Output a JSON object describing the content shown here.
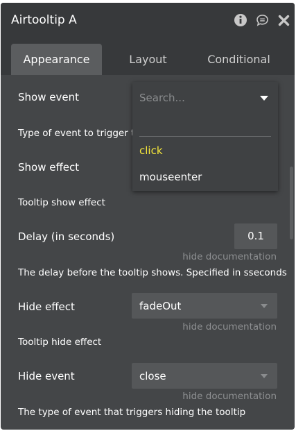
{
  "window": {
    "title": "Airtooltip A",
    "icons": [
      "info-icon",
      "comment-icon",
      "close-icon"
    ]
  },
  "tabs": [
    "Appearance",
    "Layout",
    "Conditional"
  ],
  "active_tab": "Appearance",
  "fields": {
    "show_event": {
      "label": "Show event",
      "description": "Type of event to trigger to"
    },
    "show_effect": {
      "label": "Show effect",
      "description": "Tooltip show effect"
    },
    "delay": {
      "label": "Delay (in seconds)",
      "value": "0.1",
      "doc_link": "hide documentation",
      "description": "The delay before the tooltip shows. Specified in sseconds"
    },
    "hide_effect": {
      "label": "Hide effect",
      "value": "fadeOut",
      "doc_link": "hide documentation",
      "description": "Tooltip hide effect"
    },
    "hide_event": {
      "label": "Hide event",
      "value": "close",
      "doc_link": "hide documentation",
      "description": "The type of event that triggers hiding the tooltip"
    }
  },
  "dropdown": {
    "placeholder": "Search...",
    "options": [
      "click",
      "mouseenter"
    ],
    "highlighted_option": "click",
    "highlight_color": "#f5e63a"
  },
  "colors": {
    "panel_bg": "#444648",
    "titlebar_bg": "#37393b",
    "active_tab_bg": "#5b5d5f",
    "input_bg": "#555759"
  }
}
